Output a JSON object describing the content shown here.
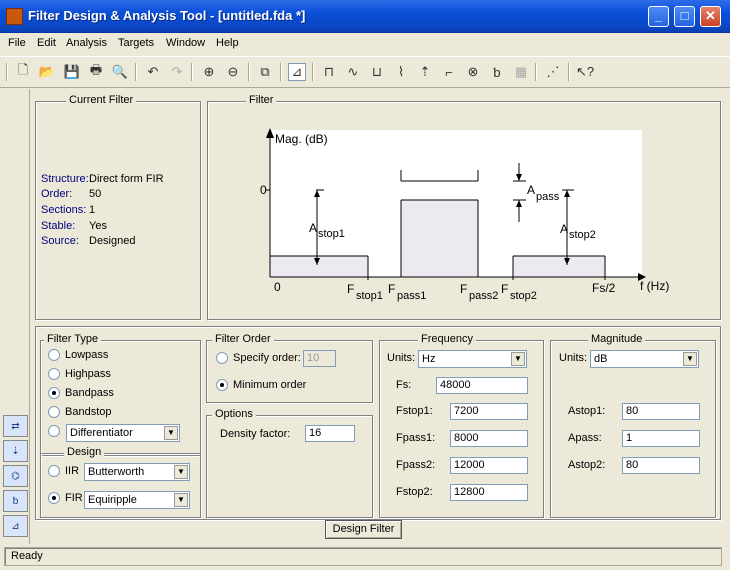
{
  "window": {
    "title": "Filter Design & Analysis Tool -  [untitled.fda *]"
  },
  "menu": [
    "File",
    "Edit",
    "Analysis",
    "Targets",
    "Window",
    "Help"
  ],
  "toolbar_icons": [
    "new-icon",
    "open-icon",
    "save-icon",
    "print-icon",
    "print-preview-icon",
    "undo-icon",
    "redo-icon",
    "zoom-in-icon",
    "zoom-out-icon",
    "full-view-icon",
    "filter-specs-icon",
    "magnitude-response-icon",
    "phase-response-icon",
    "mag-phase-icon",
    "group-delay-icon",
    "impulse-response-icon",
    "step-response-icon",
    "pole-zero-icon",
    "filter-coefficients-icon",
    "filter-info-icon",
    "legend-icon",
    "whats-this-icon"
  ],
  "current_filter": {
    "title": "Current Filter",
    "rows": [
      {
        "label": "Structure:",
        "value": "Direct form FIR"
      },
      {
        "label": "Order:",
        "value": "50"
      },
      {
        "label": "Sections:",
        "value": "1"
      },
      {
        "label": "Stable:",
        "value": "Yes"
      },
      {
        "label": "Source:",
        "value": "Designed"
      }
    ]
  },
  "filter_panel": {
    "title": "Filter",
    "ylabel": "Mag. (dB)",
    "zero_label": "0",
    "x_axis_label": "f (Hz)",
    "x0": "0",
    "astop1": {
      "main": "A",
      "sub": "stop1"
    },
    "apass": {
      "main": "A",
      "sub": "pass"
    },
    "astop2": {
      "main": "A",
      "sub": "stop2"
    },
    "fstop1": {
      "main": "F",
      "sub": "stop1"
    },
    "fpass1": {
      "main": "F",
      "sub": "pass1"
    },
    "fpass2": {
      "main": "F",
      "sub": "pass2"
    },
    "fstop2": {
      "main": "F",
      "sub": "stop2"
    },
    "fs2": "Fs/2"
  },
  "filter_type": {
    "title": "Filter Type",
    "options": [
      "Lowpass",
      "Highpass",
      "Bandpass",
      "Bandstop"
    ],
    "selected": "Bandpass",
    "other_value": "Differentiator"
  },
  "design": {
    "title": "Design",
    "iir_label": "IIR",
    "iir_value": "Butterworth",
    "fir_label": "FIR",
    "fir_value": "Equiripple",
    "selected": "FIR"
  },
  "filter_order": {
    "title": "Filter Order",
    "specify_label": "Specify order:",
    "specify_value": "10",
    "minimum_label": "Minimum order",
    "selected": "Minimum order"
  },
  "options": {
    "title": "Options",
    "density_label": "Density factor:",
    "density_value": "16"
  },
  "frequency": {
    "title": "Frequency",
    "units_label": "Units:",
    "units_value": "Hz",
    "fields": [
      {
        "label": "Fs:",
        "value": "48000"
      },
      {
        "label": "Fstop1:",
        "value": "7200"
      },
      {
        "label": "Fpass1:",
        "value": "8000"
      },
      {
        "label": "Fpass2:",
        "value": "12000"
      },
      {
        "label": "Fstop2:",
        "value": "12800"
      }
    ]
  },
  "magnitude": {
    "title": "Magnitude",
    "units_label": "Units:",
    "units_value": "dB",
    "fields": [
      {
        "label": "Astop1:",
        "value": "80"
      },
      {
        "label": "Apass:",
        "value": "1"
      },
      {
        "label": "Astop2:",
        "value": "80"
      }
    ]
  },
  "design_button": "Design Filter",
  "status": "Ready"
}
